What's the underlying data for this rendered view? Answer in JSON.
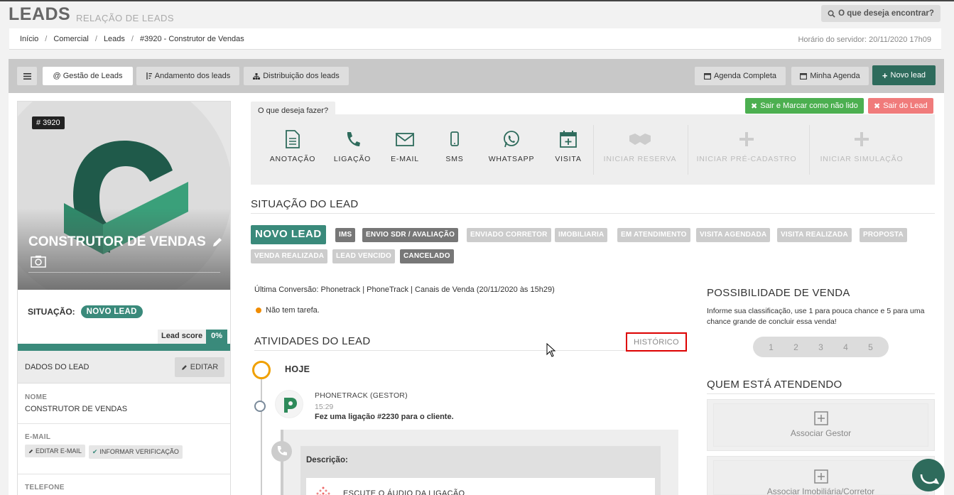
{
  "header": {
    "title": "LEADS",
    "subtitle": "RELAÇÃO DE LEADS",
    "search_label": "O que deseja encontrar?"
  },
  "breadcrumb": {
    "items": [
      "Início",
      "Comercial",
      "Leads",
      "#3920 - Construtor de Vendas"
    ],
    "server_time": "Horário do servidor: 20/11/2020 17h09"
  },
  "toolbar": {
    "menu_icon": "menu-icon",
    "tabs": [
      "@ Gestão de Leads",
      "Andamento dos leads",
      "Distribuição dos leads"
    ],
    "right_buttons": [
      "Agenda Completa",
      "Minha Agenda",
      "Novo lead"
    ]
  },
  "lead": {
    "id": "# 3920",
    "name": "CONSTRUTOR DE VENDAS",
    "situation_label": "SITUAÇÃO:",
    "situation_value": "NOVO LEAD",
    "score_label": "Lead score",
    "score_value": "0%",
    "data_header": "DADOS DO LEAD",
    "edit_label": "EDITAR",
    "name_label": "NOME",
    "name_value": "CONSTRUTOR DE VENDAS",
    "email_label": "E-MAIL",
    "email_edit": "EDITAR E-MAIL",
    "email_verify": "INFORMAR VERIFICAÇÃO",
    "phone_label": "TELEFONE"
  },
  "actions": {
    "prompt": "O que deseja fazer?",
    "items": [
      "ANOTAÇÃO",
      "LIGAÇÃO",
      "E-MAIL",
      "SMS",
      "WHATSAPP",
      "VISITA"
    ],
    "disabled": [
      "INICIAR RESERVA",
      "INICIAR PRÉ-CADASTRO",
      "INICIAR SIMULAÇÃO"
    ],
    "exit_mark": "Sair e Marcar como não lido",
    "exit": "Sair do Lead"
  },
  "situation": {
    "title": "SITUAÇÃO DO LEAD",
    "stages_row1": [
      "NOVO LEAD",
      "IMS",
      "ENVIO SDR / AVALIAÇÃO",
      "ENVIADO CORRETOR",
      "IMOBILIARIA",
      "EM ATENDIMENTO",
      "VISITA AGENDADA",
      "VISITA REALIZADA",
      "PROPOSTA"
    ],
    "stages_row2": [
      "VENDA REALIZADA",
      "LEAD VENCIDO",
      "CANCELADO"
    ]
  },
  "conversion": "Última Conversão: Phonetrack | PhoneTrack | Canais de Venda (20/11/2020 às 15h29)",
  "task": "Não tem tarefa.",
  "activities": {
    "title": "ATIVIDADES DO LEAD",
    "history": "HISTÓRICO",
    "today": "HOJE",
    "event_who": "PHONETRACK (GESTOR)",
    "event_time": "15:29",
    "event_text": "Fez uma ligação #2230 para o cliente.",
    "description_label": "Descrição:",
    "audio_label": "ESCUTE O ÁUDIO DA LIGAÇÃO"
  },
  "sale": {
    "title": "POSSIBILIDADE DE VENDA",
    "text": "Informe sua classificação, use 1 para pouca chance e 5 para uma chance grande de concluir essa venda!",
    "ratings": [
      "1",
      "2",
      "3",
      "4",
      "5"
    ]
  },
  "attending": {
    "title": "QUEM ESTÁ ATENDENDO",
    "manager": "Associar Gestor",
    "broker": "Associar Imobiliária/Corretor"
  },
  "colors": {
    "brand_green": "#2e6b5c",
    "teal": "#3a8a7b",
    "exit_red": "#f07b7b",
    "exit_green": "#4caf50",
    "highlight": "#dd0000"
  }
}
